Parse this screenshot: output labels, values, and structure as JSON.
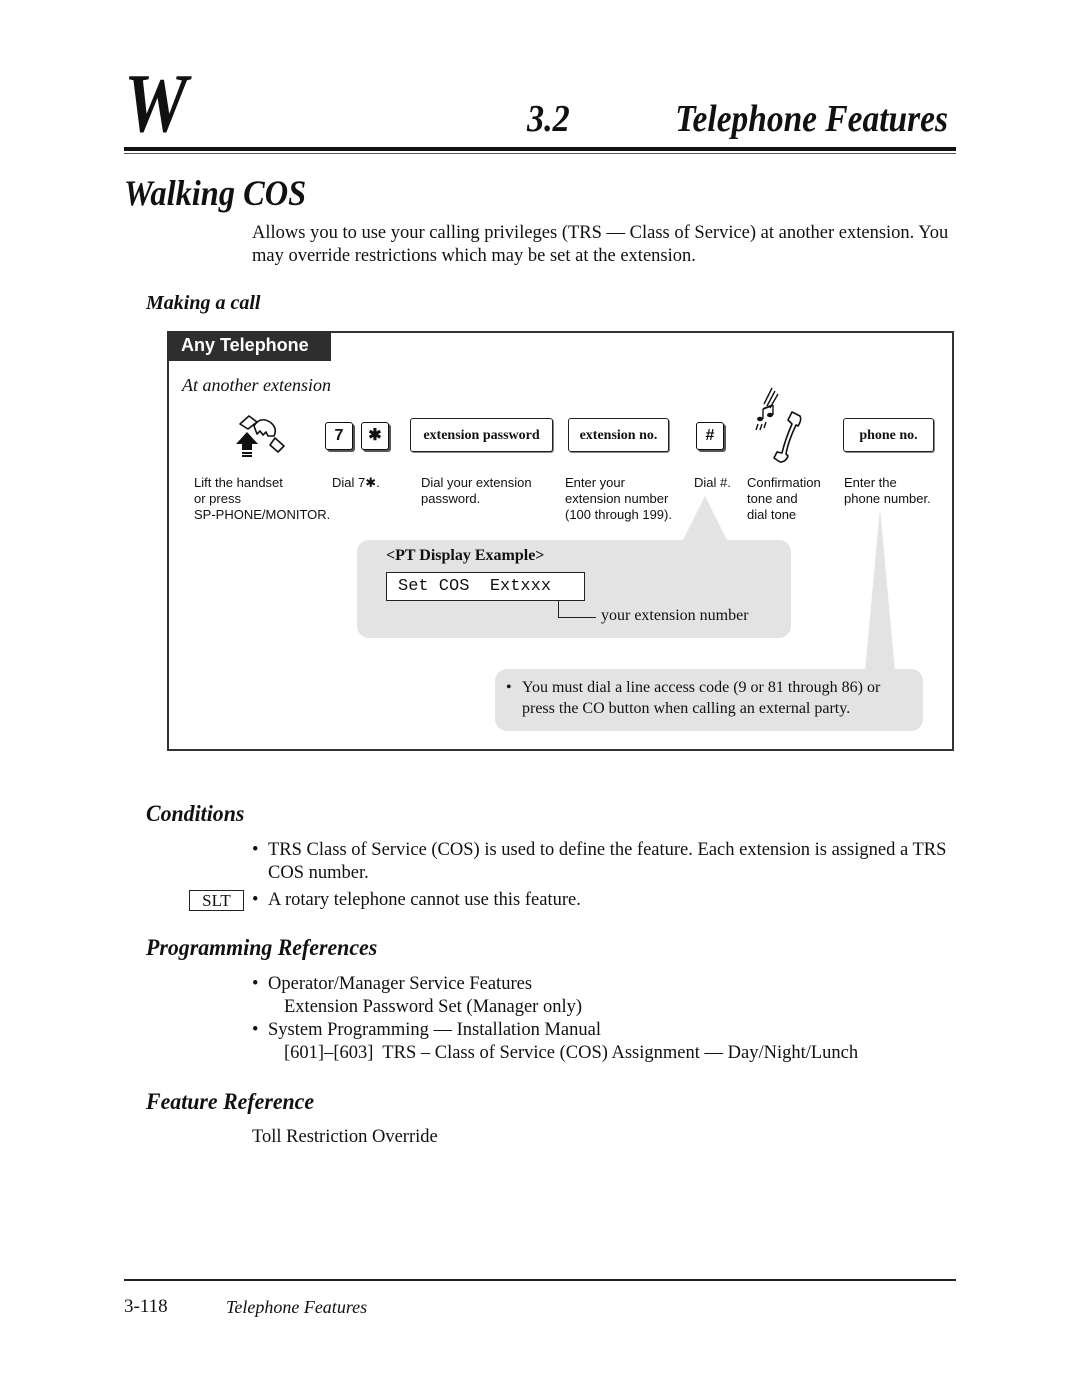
{
  "header": {
    "chapter_letter": "W",
    "section_number": "3.2",
    "section_title": "Telephone Features"
  },
  "page_title": "Walking COS",
  "intro": "Allows you to use your calling privileges (TRS — Class of Service) at another extension. You may override restrictions which may be set at the extension.",
  "making_call": {
    "heading": "Making a call",
    "tag": "Any Telephone",
    "context": "At another extension",
    "steps": [
      {
        "icon": "handset-lift-icon",
        "caption": "Lift the handset\nor press\nSP-PHONE/MONITOR."
      },
      {
        "keys": [
          "7",
          "✱"
        ],
        "caption": "Dial 7✱."
      },
      {
        "box": "extension password",
        "caption": "Dial your extension\npassword."
      },
      {
        "box": "extension no.",
        "caption": "Enter your\nextension number\n(100 through 199)."
      },
      {
        "keys": [
          "#"
        ],
        "caption": "Dial #."
      },
      {
        "icon": "confirmation-tone-icon",
        "caption": "Confirmation\ntone and\ndial tone"
      },
      {
        "box": "phone no.",
        "caption": "Enter the\nphone number."
      }
    ],
    "pt_display": {
      "title": "<PT Display Example>",
      "lcd": "Set COS  Extxxx",
      "annotation": "your extension number"
    },
    "note": "You must dial a line access code (9 or 81 through 86) or press the CO button when calling an external party."
  },
  "conditions": {
    "heading": "Conditions",
    "items": [
      {
        "text": "TRS Class of Service (COS) is used to define the feature. Each extension is assigned a TRS COS number."
      },
      {
        "badge": "SLT",
        "text": "A rotary telephone cannot use this feature."
      }
    ]
  },
  "programming_references": {
    "heading": "Programming References",
    "items": [
      {
        "title": "Operator/Manager Service Features",
        "sub": "Extension Password Set (Manager only)"
      },
      {
        "title": "System Programming — Installation Manual",
        "sub": "[601]–[603]  TRS – Class of Service (COS) Assignment — Day/Night/Lunch"
      }
    ]
  },
  "feature_reference": {
    "heading": "Feature Reference",
    "text": "Toll Restriction Override"
  },
  "footer": {
    "page_number": "3-118",
    "title": "Telephone Features"
  },
  "bullet_glyph": "•"
}
